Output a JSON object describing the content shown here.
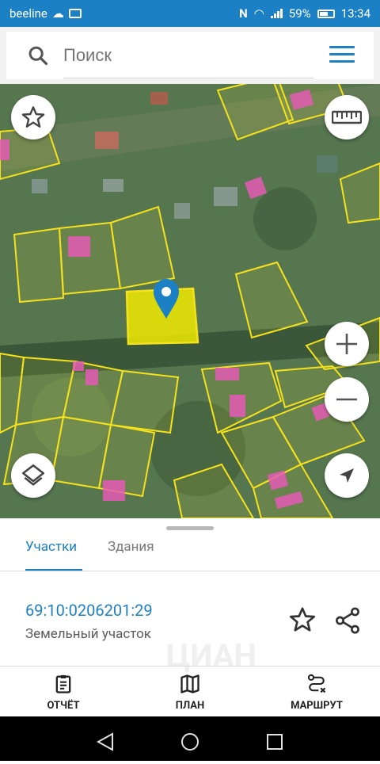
{
  "status_bar": {
    "carrier": "beeline",
    "battery": "59%",
    "time": "13:34"
  },
  "search": {
    "placeholder": "Поиск"
  },
  "tabs": [
    {
      "label": "Участки",
      "active": true
    },
    {
      "label": "Здания",
      "active": false
    }
  ],
  "parcel": {
    "number": "69:10:0206201:29",
    "type": "Земельный участок"
  },
  "actions": {
    "report": "ОТЧЁТ",
    "plan": "ПЛАН",
    "route": "МАРШРУТ"
  },
  "watermark": "ЦИАН",
  "colors": {
    "accent": "#1c80c4",
    "parcel_outline": "#f5e21c",
    "selected_parcel_fill": "#f0ea00",
    "building_fill": "#e45bb5"
  }
}
